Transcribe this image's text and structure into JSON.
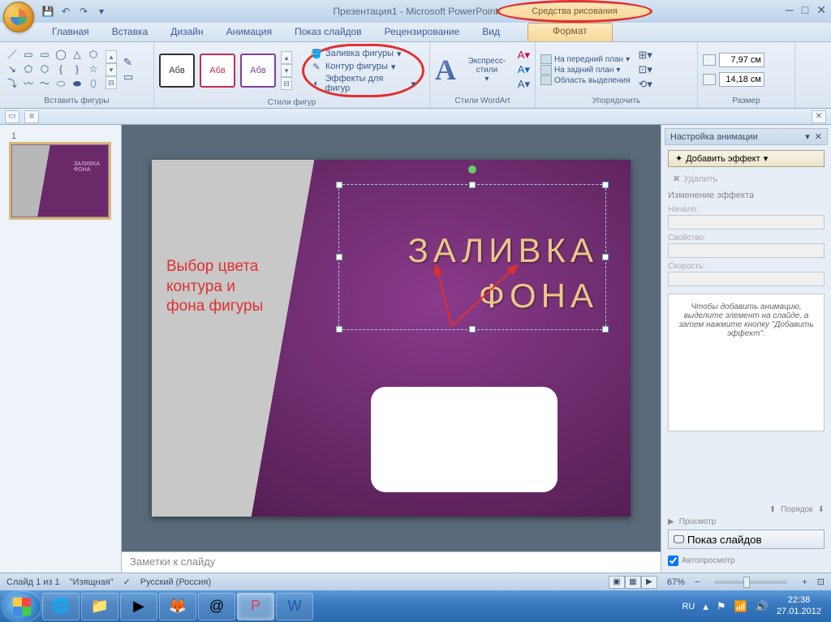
{
  "app": {
    "title": "Презентация1 - Microsoft PowerPoint",
    "contextual_label": "Средства рисования"
  },
  "tabs": {
    "home": "Главная",
    "insert": "Вставка",
    "design": "Дизайн",
    "animation": "Анимация",
    "slideshow": "Показ слайдов",
    "review": "Рецензирование",
    "view": "Вид",
    "format": "Формат"
  },
  "ribbon": {
    "insert_shapes": "Вставить фигуры",
    "shape_styles": "Стили фигур",
    "sample_text": "Абв",
    "shape_fill": "Заливка фигуры",
    "shape_outline": "Контур фигуры",
    "shape_effects": "Эффекты для фигур",
    "wordart_styles": "Стили WordArt",
    "express_styles": "Экспресс-стили",
    "arrange": "Упорядочить",
    "bring_front": "На передний план",
    "send_back": "На задний план",
    "selection_pane": "Область выделения",
    "size": "Размер",
    "height_val": "7,97 см",
    "width_val": "14,18 см"
  },
  "slide": {
    "annotation_l1": "Выбор цвета",
    "annotation_l2": "контура и",
    "annotation_l3": "фона фигуры",
    "title_l1": "ЗАЛИВКА",
    "title_l2": "ФОНА",
    "thumb_l1": "ЗАЛИВКА",
    "thumb_l2": "ФОНА",
    "notes_placeholder": "Заметки к слайду"
  },
  "anim_pane": {
    "title": "Настройка анимации",
    "add_effect": "Добавить эффект",
    "delete": "Удалить",
    "change_effect": "Изменение эффекта",
    "start": "Начало:",
    "property": "Свойство:",
    "speed": "Скорость:",
    "hint": "Чтобы добавить анимацию, выделите элемент на слайде, а затем нажмите кнопку \"Добавить эффект\".",
    "order": "Порядок",
    "preview": "Просмотр",
    "slideshow": "Показ слайдов",
    "autopreview": "Автопросмотр"
  },
  "status": {
    "slide_of": "Слайд 1 из 1",
    "theme": "\"Изящная\"",
    "lang": "Русский (Россия)",
    "zoom": "67%"
  },
  "tray": {
    "lang": "RU",
    "time": "22:38",
    "date": "27.01.2012"
  }
}
